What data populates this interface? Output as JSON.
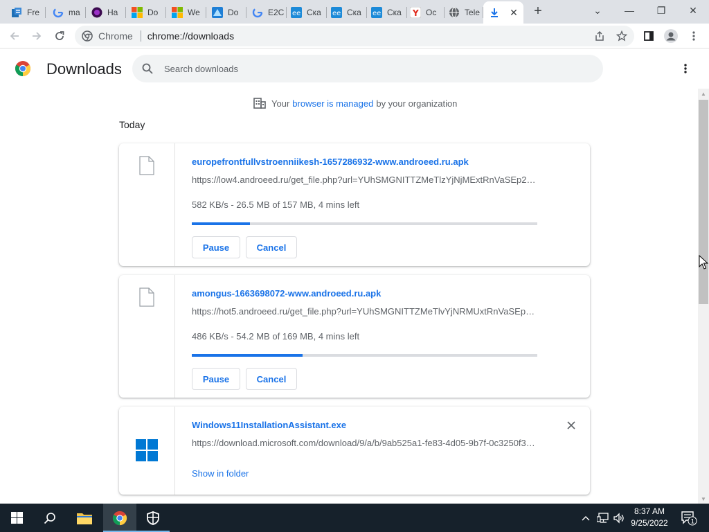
{
  "tabs": [
    {
      "title": "Fre",
      "icon": "web-document-icon"
    },
    {
      "title": "ma",
      "icon": "google-icon"
    },
    {
      "title": "Ha",
      "icon": "purple-circle-icon"
    },
    {
      "title": "Do",
      "icon": "microsoft-icon"
    },
    {
      "title": "We",
      "icon": "microsoft-icon"
    },
    {
      "title": "Do",
      "icon": "blue-square-icon"
    },
    {
      "title": "E2C",
      "icon": "google-icon"
    },
    {
      "title": "Ска",
      "icon": "androeed-icon"
    },
    {
      "title": "Ска",
      "icon": "androeed-icon"
    },
    {
      "title": "Ска",
      "icon": "androeed-icon"
    },
    {
      "title": "Ос",
      "icon": "yandex-icon"
    },
    {
      "title": "Tele",
      "icon": "globe-icon"
    },
    {
      "title": "",
      "icon": "download-icon",
      "active": true
    }
  ],
  "window_controls": {
    "tab_search": "⌄",
    "minimize": "—",
    "restore": "❐",
    "close": "✕"
  },
  "omnibox": {
    "site_label": "Chrome",
    "url": "chrome://downloads"
  },
  "header": {
    "title": "Downloads",
    "search_placeholder": "Search downloads"
  },
  "managed": {
    "prefix": "Your",
    "link": "browser is managed",
    "suffix": "by your organization"
  },
  "section": {
    "label": "Today"
  },
  "downloads": [
    {
      "name": "europefrontfullvstroenniikesh-1657286932-www.androeed.ru.apk",
      "url": "https://low4.androeed.ru/get_file.php?url=YUhSMGNITTZMeTlzYjNjMExtRnVaSEp2WlhWa0xuSjFMMlpwYkdWekx6RmhPREExTnpWall6VXdNemM0TlRJek5EVTRORGMxWmprMkxtRndhdz09",
      "status": "582 KB/s - 26.5 MB of 157 MB, 4 mins left",
      "progress": 0.169,
      "pause_label": "Pause",
      "cancel_label": "Cancel"
    },
    {
      "name": "amongus-1663698072-www.androeed.ru.apk",
      "url": "https://hot5.androeed.ru/get_file.php?url=YUhSMGNITTZMeTlvYjNRMUxtRnVaSEp2WlhWa0xuSjFMMlpwYkdWekx6VXdaakU0TjJGbVl6VXdNemM0TlRJek5EVTRORGMxWmprMkxtRndhdz09",
      "status": "486 KB/s - 54.2 MB of 169 MB, 4 mins left",
      "progress": 0.321,
      "pause_label": "Pause",
      "cancel_label": "Cancel"
    },
    {
      "name": "Windows11InstallationAssistant.exe",
      "url": "https://download.microsoft.com/download/9/a/b/9ab525a1-fe83-4d05-9b7f-0c3250f3af3c/Windows11InstallationAssistant.exe",
      "show_in_folder": "Show in folder"
    }
  ],
  "clock": {
    "time": "8:37 AM",
    "date": "9/25/2022"
  },
  "notifications": {
    "count": "1"
  },
  "colors": {
    "accent": "#1a73e8",
    "taskbar": "#16212b",
    "tabstrip": "#dee1e6"
  }
}
